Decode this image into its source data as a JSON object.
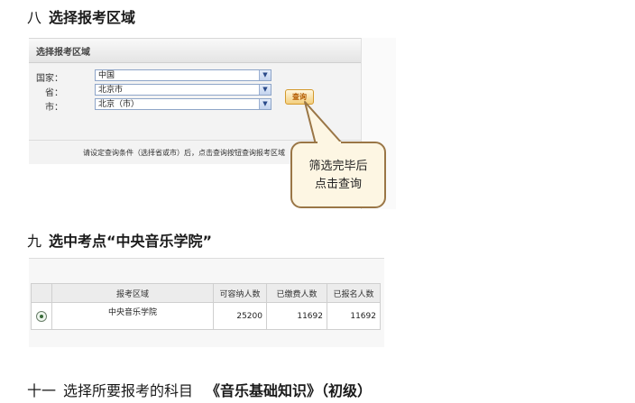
{
  "section8": {
    "number": "八",
    "title": "选择报考区域",
    "panel_title": "选择报考区域",
    "fields": [
      {
        "label": "国家：",
        "value": "中国"
      },
      {
        "label": "省：",
        "value": "北京市"
      },
      {
        "label": "市：",
        "value": "北京（市）"
      }
    ],
    "query_button": "查询",
    "note": "请设定查询条件（选择省或市）后，点击查询按钮查询报考区域",
    "callout_line1": "筛选完毕后",
    "callout_line2": "点击查询"
  },
  "section9": {
    "number": "九",
    "title": "选中考点“中央音乐学院”",
    "table": {
      "headers": [
        "",
        "报考区域",
        "可容纳人数",
        "已缴费人数",
        "已报名人数"
      ],
      "row": {
        "area": "中央音乐学院",
        "capacity": "25200",
        "paid": "11692",
        "registered": "11692"
      }
    }
  },
  "section11": {
    "number": "十一",
    "title_prefix": "选择所要报考的科目",
    "title_subject": "《音乐基础知识》（初级）"
  },
  "colors": {
    "highlight_header": "#cc0000",
    "callout_border": "#9a7646"
  }
}
